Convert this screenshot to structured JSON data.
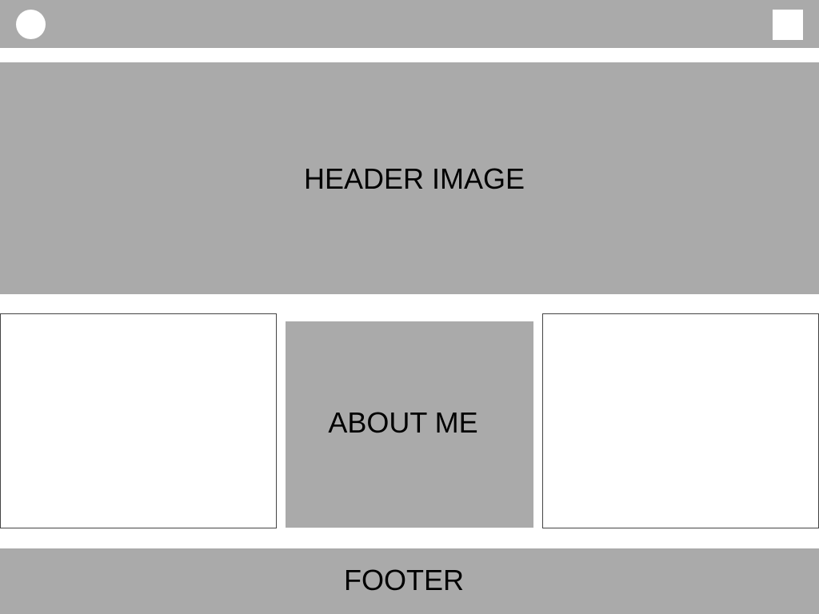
{
  "topbar": {
    "left_icon": "circle-icon",
    "right_icon": "square-icon"
  },
  "header": {
    "label": "HEADER IMAGE"
  },
  "content": {
    "about_label": "ABOUT ME"
  },
  "footer": {
    "label": "FOOTER"
  },
  "colors": {
    "placeholder_gray": "#aaaaaa",
    "background": "#ffffff",
    "outline": "#444444"
  }
}
